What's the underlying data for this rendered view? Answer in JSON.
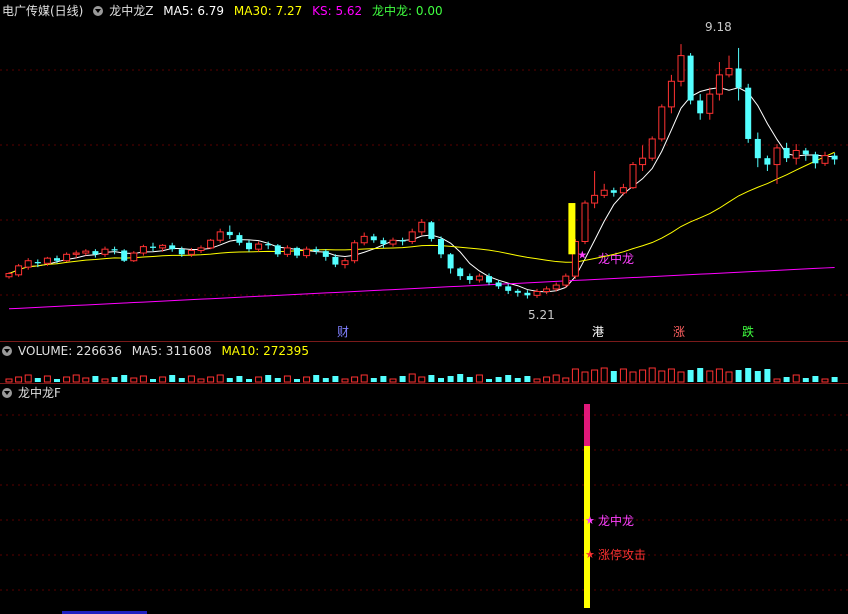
{
  "price_panel": {
    "stock_name": "电广传媒(日线)",
    "indicator_name": "龙中龙Z",
    "ma5_label": "MA5: 6.79",
    "ma30_label": "MA30: 7.27",
    "ks_label": "KS: 5.62",
    "lzl_label": "龙中龙: 0.00",
    "high_label": "9.18",
    "low_label": "5.21",
    "signal_label": "龙中龙",
    "tags": [
      {
        "text": "财",
        "color": "#8080ff"
      },
      {
        "text": "港",
        "color": "#ffffff"
      },
      {
        "text": "涨",
        "color": "#ff6060"
      },
      {
        "text": "跌",
        "color": "#40ff40"
      }
    ]
  },
  "volume_panel": {
    "volume_label": "VOLUME: 226636",
    "ma5_label": "MA5: 311608",
    "ma10_label": "MA10: 272395"
  },
  "indicator_panel": {
    "title": "龙中龙F",
    "signal1": "龙中龙",
    "signal2": "涨停攻击"
  },
  "colors": {
    "up": "#ff3232",
    "down": "#54ffff",
    "ma5": "#ffffff",
    "ma30": "#ffff00",
    "ks": "#ff00ff",
    "highlight": "#ffff00"
  },
  "chart_data": {
    "type": "candlestick",
    "price_range": [
      5.0,
      9.4
    ],
    "candles": [
      [
        5.55,
        5.6,
        5.52,
        5.62
      ],
      [
        5.58,
        5.72,
        5.55,
        5.75
      ],
      [
        5.7,
        5.8,
        5.66,
        5.84
      ],
      [
        5.78,
        5.76,
        5.7,
        5.82
      ],
      [
        5.76,
        5.84,
        5.72,
        5.86
      ],
      [
        5.84,
        5.8,
        5.76,
        5.88
      ],
      [
        5.8,
        5.9,
        5.78,
        5.93
      ],
      [
        5.9,
        5.92,
        5.84,
        5.96
      ],
      [
        5.92,
        5.95,
        5.88,
        5.98
      ],
      [
        5.95,
        5.9,
        5.85,
        5.98
      ],
      [
        5.9,
        5.98,
        5.86,
        6.02
      ],
      [
        5.98,
        5.96,
        5.9,
        6.02
      ],
      [
        5.96,
        5.8,
        5.78,
        5.98
      ],
      [
        5.8,
        5.92,
        5.78,
        5.95
      ],
      [
        5.92,
        6.02,
        5.88,
        6.05
      ],
      [
        6.02,
        6.0,
        5.95,
        6.08
      ],
      [
        6.0,
        6.04,
        5.94,
        6.06
      ],
      [
        6.04,
        5.98,
        5.94,
        6.08
      ],
      [
        5.98,
        5.9,
        5.86,
        6.02
      ],
      [
        5.9,
        5.96,
        5.86,
        6.0
      ],
      [
        5.96,
        6.0,
        5.92,
        6.04
      ],
      [
        6.0,
        6.12,
        5.98,
        6.14
      ],
      [
        6.12,
        6.25,
        6.08,
        6.3
      ],
      [
        6.25,
        6.2,
        6.14,
        6.35
      ],
      [
        6.2,
        6.08,
        6.04,
        6.24
      ],
      [
        6.08,
        5.98,
        5.94,
        6.12
      ],
      [
        5.98,
        6.06,
        5.94,
        6.1
      ],
      [
        6.06,
        6.04,
        5.98,
        6.1
      ],
      [
        6.04,
        5.9,
        5.86,
        6.06
      ],
      [
        5.9,
        6.0,
        5.86,
        6.04
      ],
      [
        6.0,
        5.88,
        5.84,
        6.02
      ],
      [
        5.88,
        5.98,
        5.84,
        6.02
      ],
      [
        5.98,
        5.95,
        5.9,
        6.02
      ],
      [
        5.95,
        5.86,
        5.8,
        5.98
      ],
      [
        5.86,
        5.74,
        5.7,
        5.9
      ],
      [
        5.74,
        5.8,
        5.68,
        5.84
      ],
      [
        5.8,
        6.08,
        5.76,
        6.12
      ],
      [
        6.08,
        6.18,
        6.04,
        6.24
      ],
      [
        6.18,
        6.12,
        6.08,
        6.22
      ],
      [
        6.12,
        6.06,
        6.0,
        6.16
      ],
      [
        6.06,
        6.12,
        6.02,
        6.16
      ],
      [
        6.12,
        6.1,
        6.04,
        6.16
      ],
      [
        6.1,
        6.25,
        6.06,
        6.3
      ],
      [
        6.25,
        6.4,
        6.2,
        6.45
      ],
      [
        6.4,
        6.14,
        6.1,
        6.42
      ],
      [
        6.14,
        5.9,
        5.84,
        6.18
      ],
      [
        5.9,
        5.68,
        5.6,
        5.92
      ],
      [
        5.68,
        5.56,
        5.5,
        5.7
      ],
      [
        5.56,
        5.5,
        5.44,
        5.6
      ],
      [
        5.5,
        5.56,
        5.46,
        5.6
      ],
      [
        5.56,
        5.46,
        5.42,
        5.6
      ],
      [
        5.46,
        5.4,
        5.36,
        5.5
      ],
      [
        5.4,
        5.33,
        5.28,
        5.44
      ],
      [
        5.33,
        5.3,
        5.24,
        5.36
      ],
      [
        5.3,
        5.26,
        5.21,
        5.34
      ],
      [
        5.26,
        5.32,
        5.22,
        5.36
      ],
      [
        5.32,
        5.36,
        5.28,
        5.4
      ],
      [
        5.36,
        5.42,
        5.32,
        5.46
      ],
      [
        5.42,
        5.56,
        5.38,
        5.6
      ],
      [
        5.56,
        6.1,
        5.52,
        6.14
      ],
      [
        6.1,
        6.7,
        6.06,
        6.74
      ],
      [
        6.7,
        6.82,
        6.62,
        7.2
      ],
      [
        6.82,
        6.9,
        6.78,
        7.0
      ],
      [
        6.9,
        6.86,
        6.8,
        6.94
      ],
      [
        6.86,
        6.94,
        6.82,
        7.0
      ],
      [
        6.94,
        7.3,
        6.92,
        7.34
      ],
      [
        7.3,
        7.4,
        7.2,
        7.6
      ],
      [
        7.4,
        7.7,
        7.36,
        7.74
      ],
      [
        7.7,
        8.2,
        7.66,
        8.24
      ],
      [
        8.2,
        8.6,
        8.1,
        8.7
      ],
      [
        8.6,
        9.0,
        8.52,
        9.18
      ],
      [
        9.0,
        8.3,
        8.24,
        9.04
      ],
      [
        8.3,
        8.1,
        8.0,
        8.4
      ],
      [
        8.1,
        8.4,
        8.0,
        8.5
      ],
      [
        8.4,
        8.7,
        8.3,
        8.9
      ],
      [
        8.7,
        8.8,
        8.66,
        9.0
      ],
      [
        8.8,
        8.5,
        8.3,
        9.12
      ],
      [
        8.5,
        7.7,
        7.64,
        8.56
      ],
      [
        7.7,
        7.4,
        7.26,
        7.8
      ],
      [
        7.4,
        7.3,
        7.2,
        7.44
      ],
      [
        7.3,
        7.56,
        7.0,
        7.62
      ],
      [
        7.56,
        7.4,
        7.34,
        7.64
      ],
      [
        7.4,
        7.52,
        7.3,
        7.62
      ],
      [
        7.52,
        7.46,
        7.36,
        7.56
      ],
      [
        7.46,
        7.32,
        7.24,
        7.5
      ],
      [
        7.32,
        7.44,
        7.28,
        7.5
      ],
      [
        7.44,
        7.38,
        7.3,
        7.48
      ]
    ]
  }
}
